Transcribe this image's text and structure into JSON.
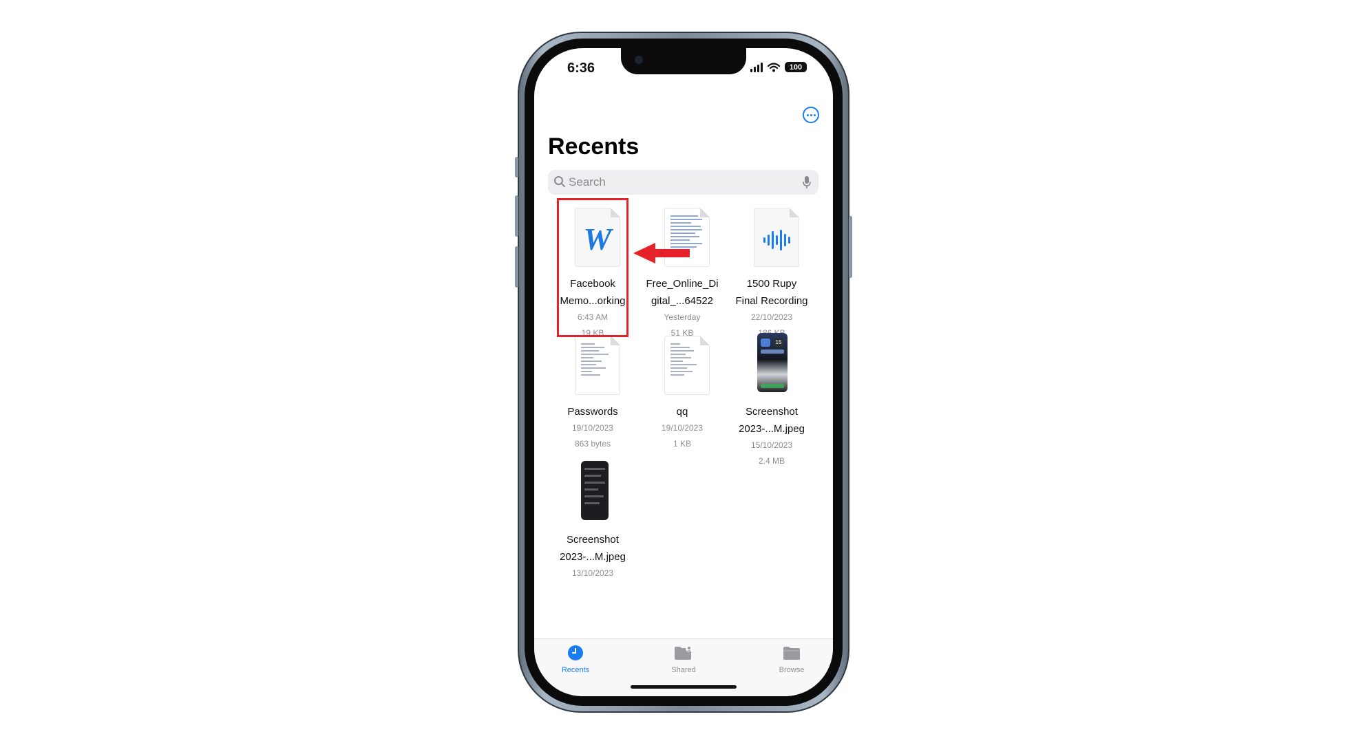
{
  "status_bar": {
    "time": "6:36",
    "battery": "100"
  },
  "header": {
    "title": "Recents",
    "more_icon": "ellipsis-circle-icon"
  },
  "search": {
    "placeholder": "Search",
    "search_icon": "magnifier-icon",
    "mic_icon": "microphone-icon"
  },
  "files": [
    {
      "name_line1": "Facebook",
      "name_line2": "Memo...orking",
      "date": "6:43 AM",
      "size": "19 KB",
      "icon": "word-document-icon"
    },
    {
      "name_line1": "Free_Online_Di",
      "name_line2": "gital_...64522",
      "date": "Yesterday",
      "size": "51 KB",
      "icon": "document-thumbnail-icon"
    },
    {
      "name_line1": "1500 Rupy",
      "name_line2": "Final Recording",
      "date": "22/10/2023",
      "size": "186 KB",
      "icon": "audio-waveform-icon"
    },
    {
      "name_line1": "Passwords",
      "name_line2": "",
      "date": "19/10/2023",
      "size": "863 bytes",
      "icon": "text-document-icon"
    },
    {
      "name_line1": "qq",
      "name_line2": "",
      "date": "19/10/2023",
      "size": "1 KB",
      "icon": "text-document-icon"
    },
    {
      "name_line1": "Screenshot",
      "name_line2": "2023-...M.jpeg",
      "date": "15/10/2023",
      "size": "2.4 MB",
      "icon": "screenshot-thumbnail-icon"
    },
    {
      "name_line1": "Screenshot",
      "name_line2": "2023-...M.jpeg",
      "date": "13/10/2023",
      "size": "",
      "icon": "screenshot-thumbnail-icon"
    }
  ],
  "tabbar": {
    "tabs": [
      {
        "label": "Recents",
        "icon": "clock-icon",
        "active": true
      },
      {
        "label": "Shared",
        "icon": "shared-folder-icon",
        "active": false
      },
      {
        "label": "Browse",
        "icon": "folder-icon",
        "active": false
      }
    ]
  },
  "colors": {
    "accent": "#1a7cf2",
    "annotation": "#e52229"
  }
}
